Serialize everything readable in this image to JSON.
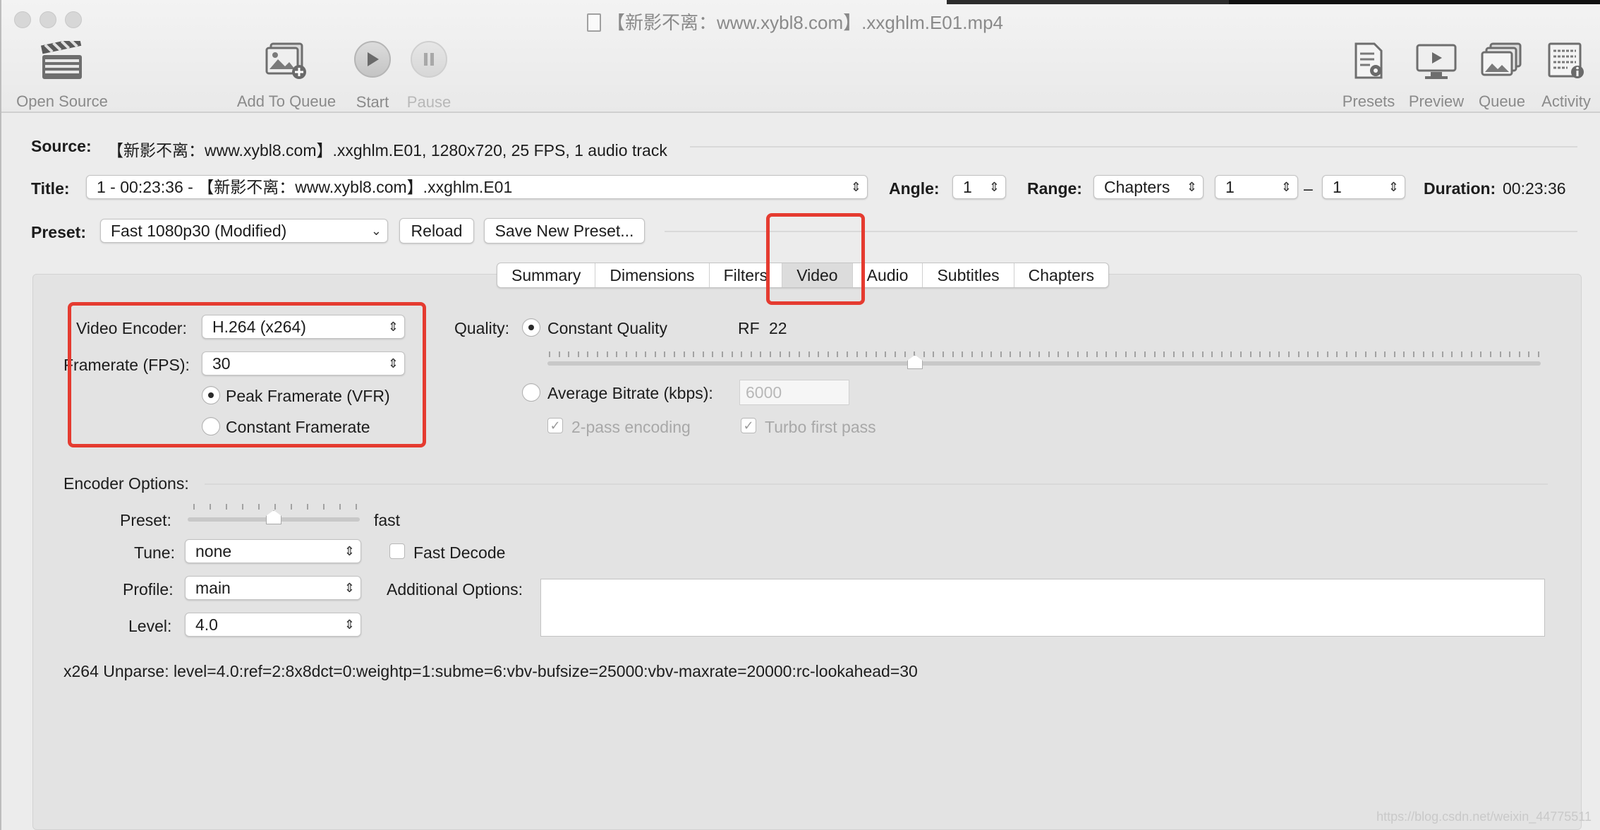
{
  "window": {
    "title": "【新影不离：www.xybl8.com】.xxghlm.E01.mp4"
  },
  "toolbar": {
    "open_source": "Open Source",
    "add_to_queue": "Add To Queue",
    "start": "Start",
    "pause": "Pause",
    "presets": "Presets",
    "preview": "Preview",
    "queue": "Queue",
    "activity": "Activity"
  },
  "source": {
    "label": "Source:",
    "value": "【新影不离：www.xybl8.com】.xxghlm.E01, 1280x720, 25 FPS, 1 audio track"
  },
  "title_row": {
    "label": "Title:",
    "value": "1 - 00:23:36 - 【新影不离：www.xybl8.com】.xxghlm.E01",
    "angle_label": "Angle:",
    "angle_value": "1",
    "range_label": "Range:",
    "range_type": "Chapters",
    "range_start": "1",
    "range_dash": "–",
    "range_end": "1",
    "duration_label": "Duration:",
    "duration_value": "00:23:36"
  },
  "preset_row": {
    "label": "Preset:",
    "value": "Fast 1080p30 (Modified)",
    "reload": "Reload",
    "save_new": "Save New Preset..."
  },
  "tabs": [
    "Summary",
    "Dimensions",
    "Filters",
    "Video",
    "Audio",
    "Subtitles",
    "Chapters"
  ],
  "active_tab": "Video",
  "video": {
    "encoder_label": "Video Encoder:",
    "encoder_value": "H.264 (x264)",
    "framerate_label": "Framerate (FPS):",
    "framerate_value": "30",
    "peak_vfr": "Peak Framerate (VFR)",
    "constant_fr": "Constant Framerate",
    "framerate_mode": "peak",
    "quality_label": "Quality:",
    "constant_quality": "Constant Quality",
    "rf_label": "RF",
    "rf_value": "22",
    "rf_slider_fraction": 0.37,
    "average_bitrate": "Average Bitrate (kbps):",
    "bitrate_value": "6000",
    "two_pass": "2-pass encoding",
    "turbo": "Turbo first pass",
    "quality_mode": "constant"
  },
  "encoder_options": {
    "heading": "Encoder Options:",
    "preset_label": "Preset:",
    "preset_value": "fast",
    "preset_slider_fraction": 0.5,
    "tune_label": "Tune:",
    "tune_value": "none",
    "fast_decode": "Fast Decode",
    "profile_label": "Profile:",
    "profile_value": "main",
    "additional_label": "Additional Options:",
    "level_label": "Level:",
    "level_value": "4.0",
    "unparse": "x264 Unparse: level=4.0:ref=2:8x8dct=0:weightp=1:subme=6:vbv-bufsize=25000:vbv-maxrate=20000:rc-lookahead=30"
  },
  "watermark": "https://blog.csdn.net/weixin_44775511",
  "colors": {
    "annotation": "#e53b30",
    "window_bg": "#ececec"
  }
}
